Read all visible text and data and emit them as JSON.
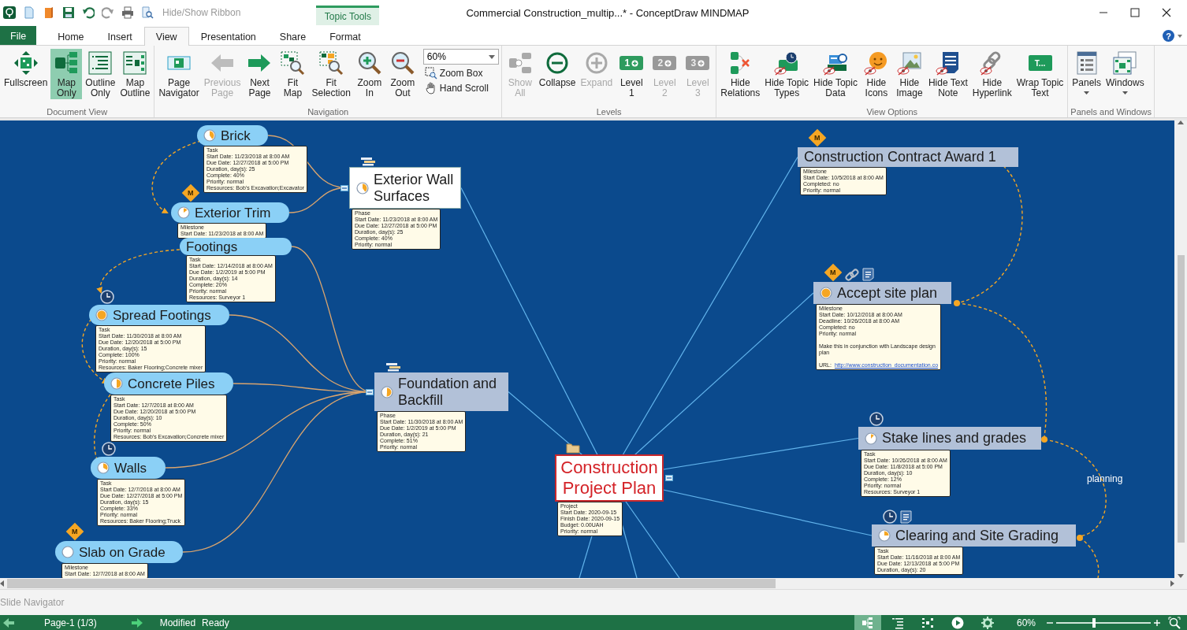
{
  "title_bar": {
    "ribbon_toggle": "Hide/Show Ribbon",
    "context_tab": "Topic Tools",
    "title": "Commercial Construction_multip...* - ConceptDraw MINDMAP"
  },
  "tabs": [
    {
      "label": "File",
      "kind": "file",
      "selected": false
    },
    {
      "label": "Home",
      "kind": "tab",
      "selected": false
    },
    {
      "label": "Insert",
      "kind": "tab",
      "selected": false
    },
    {
      "label": "View",
      "kind": "tab",
      "selected": true
    },
    {
      "label": "Presentation",
      "kind": "tab",
      "selected": false
    },
    {
      "label": "Share",
      "kind": "tab",
      "selected": false
    },
    {
      "label": "Format",
      "kind": "tab",
      "selected": false
    }
  ],
  "help_button": "?",
  "ribbon": {
    "groups": [
      {
        "label": "Document View",
        "buttons": [
          {
            "label": "Fullscreen",
            "selected": false,
            "disabled": false
          },
          {
            "label": "Map\nOnly",
            "selected": true,
            "disabled": false
          },
          {
            "label": "Outline\nOnly",
            "selected": false,
            "disabled": false
          },
          {
            "label": "Map\nOutline",
            "selected": false,
            "disabled": false
          }
        ]
      },
      {
        "label": "Navigation",
        "buttons": [
          {
            "label": "Page\nNavigator",
            "disabled": false
          },
          {
            "label": "Previous\nPage",
            "disabled": true
          },
          {
            "label": "Next\nPage",
            "disabled": false
          },
          {
            "label": "Fit\nMap",
            "disabled": false
          },
          {
            "label": "Fit\nSelection",
            "disabled": false
          },
          {
            "label": "Zoom\nIn",
            "disabled": false
          },
          {
            "label": "Zoom\nOut",
            "disabled": false
          }
        ],
        "combo": "60%",
        "small_buttons": [
          {
            "label": "Zoom Box"
          },
          {
            "label": "Hand Scroll"
          }
        ]
      },
      {
        "label": "Levels",
        "buttons": [
          {
            "label": "Show\nAll",
            "disabled": true
          },
          {
            "label": "Collapse",
            "disabled": false
          },
          {
            "label": "Expand",
            "disabled": true
          },
          {
            "label": "Level\n1",
            "icon_text": "1",
            "disabled": false
          },
          {
            "label": "Level\n2",
            "icon_text": "2",
            "disabled": true
          },
          {
            "label": "Level\n3",
            "icon_text": "3",
            "disabled": true
          }
        ]
      },
      {
        "label": "View Options",
        "buttons": [
          {
            "label": "Hide\nRelations",
            "disabled": false
          },
          {
            "label": "Hide Topic\nTypes",
            "disabled": false
          },
          {
            "label": "Hide Topic\nData",
            "disabled": false
          },
          {
            "label": "Hide\nIcons",
            "disabled": false
          },
          {
            "label": "Hide\nImage",
            "disabled": false
          },
          {
            "label": "Hide Text\nNote",
            "disabled": false
          },
          {
            "label": "Hide\nHyperlink",
            "disabled": false
          },
          {
            "label": "Wrap Topic\nText",
            "icon_text": "T...",
            "disabled": false
          }
        ]
      },
      {
        "label": "Panels and Windows",
        "buttons": [
          {
            "label": "Panels",
            "dropdown": true,
            "disabled": false
          },
          {
            "label": "Windows",
            "dropdown": true,
            "disabled": false
          }
        ]
      }
    ]
  },
  "map": {
    "relation_label": "planning",
    "root": {
      "label": "Construction Project Plan",
      "kind": "root",
      "expanded": true,
      "badges": [
        {
          "kind": "folder"
        }
      ],
      "note": {
        "lines": [
          "Project",
          "Start Date: 2020-09-15",
          "Finish Date: 2020-09-15",
          "Budget: 0.00UAH",
          "Priority: normal"
        ]
      },
      "children": [
        {
          "label": "Exterior Wall Surfaces",
          "kind": "box",
          "selected": true,
          "expanded": true,
          "badges": [
            {
              "kind": "phase"
            }
          ],
          "note": {
            "lines": [
              "Phase",
              "Start Date: 11/23/2018 at 8:00 AM",
              "Due Date: 12/27/2018 at 5:00 PM",
              "Duration, day(s): 25",
              "Complete: 40%",
              "Priority: normal"
            ]
          },
          "children": [
            {
              "label": "Brick",
              "kind": "bubble",
              "selected": false,
              "note": {
                "lines": [
                  "Task",
                  "Start Date: 11/23/2018 at 8:00 AM",
                  "Due Date: 12/27/2018 at 5:00 PM",
                  "Duration, day(s): 25",
                  "Complete: 40%",
                  "Priority: normal",
                  "Resources: Bob's Excavation;Excavator"
                ]
              }
            },
            {
              "label": "Exterior Trim",
              "kind": "bubble",
              "selected": false,
              "badges": [
                {
                  "kind": "milestone",
                  "text": "M"
                }
              ],
              "note": {
                "lines": [
                  "Milestone",
                  "Start Date: 11/23/2018 at 8:00 AM"
                ]
              }
            }
          ]
        },
        {
          "label": "Foundation and Backfill",
          "kind": "box",
          "selected": false,
          "expanded": true,
          "badges": [
            {
              "kind": "phase"
            }
          ],
          "note": {
            "lines": [
              "Phase",
              "Start Date: 11/30/2018 at 8:00 AM",
              "Due Date: 1/2/2019 at 5:00 PM",
              "Duration, day(s): 21",
              "Complete: 51%",
              "Priority: normal"
            ]
          },
          "children": [
            {
              "label": "Footings",
              "kind": "bubble",
              "selected": false,
              "note": {
                "lines": [
                  "Task",
                  "Start Date: 12/14/2018 at 8:00 AM",
                  "Due Date: 1/2/2019 at 5:00 PM",
                  "Duration, day(s): 14",
                  "Complete: 20%",
                  "Priority: normal",
                  "Resources: Surveyor 1"
                ]
              }
            },
            {
              "label": "Spread Footings",
              "kind": "bubble",
              "selected": false,
              "badges": [
                {
                  "kind": "clock"
                }
              ],
              "note": {
                "lines": [
                  "Task",
                  "Start Date: 11/30/2018 at 8:00 AM",
                  "Due Date: 12/20/2018 at 5:00 PM",
                  "Duration, day(s): 15",
                  "Complete: 100%",
                  "Priority: normal",
                  "Resources: Baker Flooring;Concrete mixer"
                ]
              }
            },
            {
              "label": "Concrete Piles",
              "kind": "bubble",
              "selected": false,
              "note": {
                "lines": [
                  "Task",
                  "Start Date: 12/7/2018 at 8:00 AM",
                  "Due Date: 12/20/2018 at 5:00 PM",
                  "Duration, day(s): 10",
                  "Complete: 50%",
                  "Priority: normal",
                  "Resources: Bob's Excavation;Concrete mixer"
                ]
              }
            },
            {
              "label": "Walls",
              "kind": "bubble",
              "selected": false,
              "badges": [
                {
                  "kind": "clock"
                }
              ],
              "note": {
                "lines": [
                  "Task",
                  "Start Date: 12/7/2018 at 8:00 AM",
                  "Due Date: 12/27/2018 at 5:00 PM",
                  "Duration, day(s): 15",
                  "Complete: 33%",
                  "Priority: normal",
                  "Resources: Baker Flooring;Truck"
                ]
              }
            },
            {
              "label": "Slab on Grade",
              "kind": "bubble",
              "selected": false,
              "badges": [
                {
                  "kind": "milestone",
                  "text": "M"
                }
              ],
              "note": {
                "lines": [
                  "Milestone",
                  "Start Date: 12/7/2018 at 8:00 AM"
                ]
              }
            }
          ]
        },
        {
          "label": "Construction Contract Award 1",
          "kind": "box",
          "selected": false,
          "badges": [
            {
              "kind": "milestone",
              "text": "M"
            }
          ],
          "note": {
            "lines": [
              "Milestone",
              "Start Date: 10/5/2018 at 8:00 AM",
              "Completed: no",
              "Priority: normal"
            ]
          }
        },
        {
          "label": "Accept site plan",
          "kind": "box",
          "selected": false,
          "badges": [
            {
              "kind": "milestone",
              "text": "M"
            },
            {
              "kind": "link"
            },
            {
              "kind": "note"
            }
          ],
          "note": {
            "lines": [
              "Milestone",
              "Start Date: 10/12/2018 at 8:00 AM",
              "Deadline: 10/26/2018 at 8:00 AM",
              "Completed: no",
              "Priority: normal"
            ],
            "text": "Make this in conjunction with Landscape design plan",
            "url_label": "URL:",
            "url": "http://www.construction_documentation.co"
          }
        },
        {
          "label": "Stake lines and grades",
          "kind": "box",
          "selected": false,
          "badges": [
            {
              "kind": "clock"
            }
          ],
          "note": {
            "lines": [
              "Task",
              "Start Date: 10/26/2018 at 8:00 AM",
              "Due Date: 11/8/2018 at 5:00 PM",
              "Duration, day(s): 10",
              "Complete: 12%",
              "Priority: normal",
              "Resources: Surveyor 1"
            ]
          }
        },
        {
          "label": "Clearing and Site Grading",
          "kind": "box",
          "selected": false,
          "badges": [
            {
              "kind": "clock"
            },
            {
              "kind": "note"
            }
          ],
          "note": {
            "lines": [
              "Task",
              "Start Date: 11/16/2018 at 8:00 AM",
              "Due Date: 12/13/2018 at 5:00 PM",
              "Duration, day(s): 20"
            ]
          }
        }
      ]
    }
  },
  "slide_navigator": {
    "label": "Slide Navigator"
  },
  "status_bar": {
    "page": "Page-1 (1/3)",
    "modified": "Modified",
    "state": "Ready",
    "view_buttons": [
      {
        "selected": true
      },
      {
        "selected": false
      },
      {
        "selected": false
      },
      {
        "selected": false
      },
      {
        "selected": false
      }
    ],
    "zoom": "60%",
    "zoom_slider": {
      "level": 0.4
    }
  }
}
